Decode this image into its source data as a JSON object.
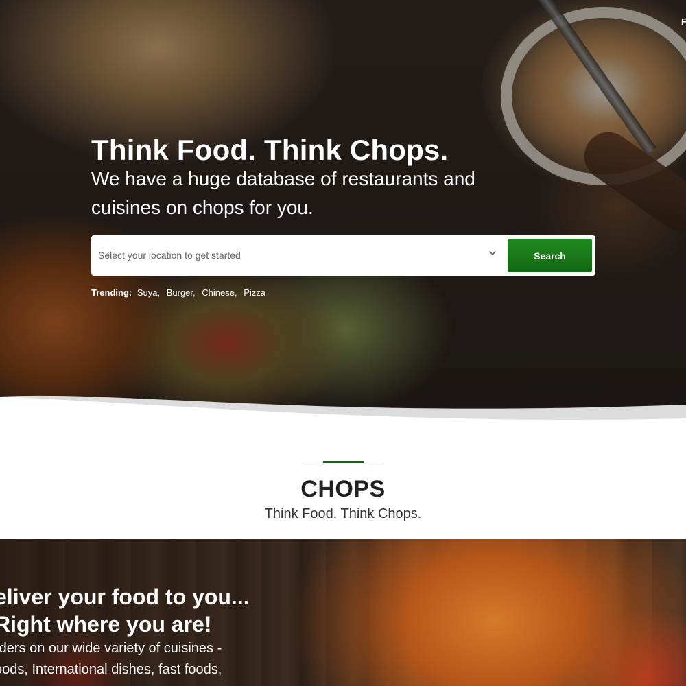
{
  "hero": {
    "title": "Think Food. Think Chops.",
    "subtitle": "We have a huge database of restaurants and cuisines on chops for you.",
    "search": {
      "placeholder": "Select your location to get started",
      "button_label": "Search"
    },
    "trending": {
      "label": "Trending:",
      "items": [
        "Suya,",
        "Burger,",
        "Chinese,",
        "Pizza"
      ]
    },
    "corner_text": "F"
  },
  "about": {
    "title": "CHOPS",
    "subtitle": "Think Food. Think Chops."
  },
  "promo": {
    "title_line1": "eliver your food to you...",
    "title_line2": "Right where you are!",
    "text_line1": "rders on our wide variety of cuisines -",
    "text_line2": "oods, International dishes, fast foods,"
  },
  "colors": {
    "accent_green": "#1f8a1f",
    "divider_accent": "#1e5b1e"
  }
}
